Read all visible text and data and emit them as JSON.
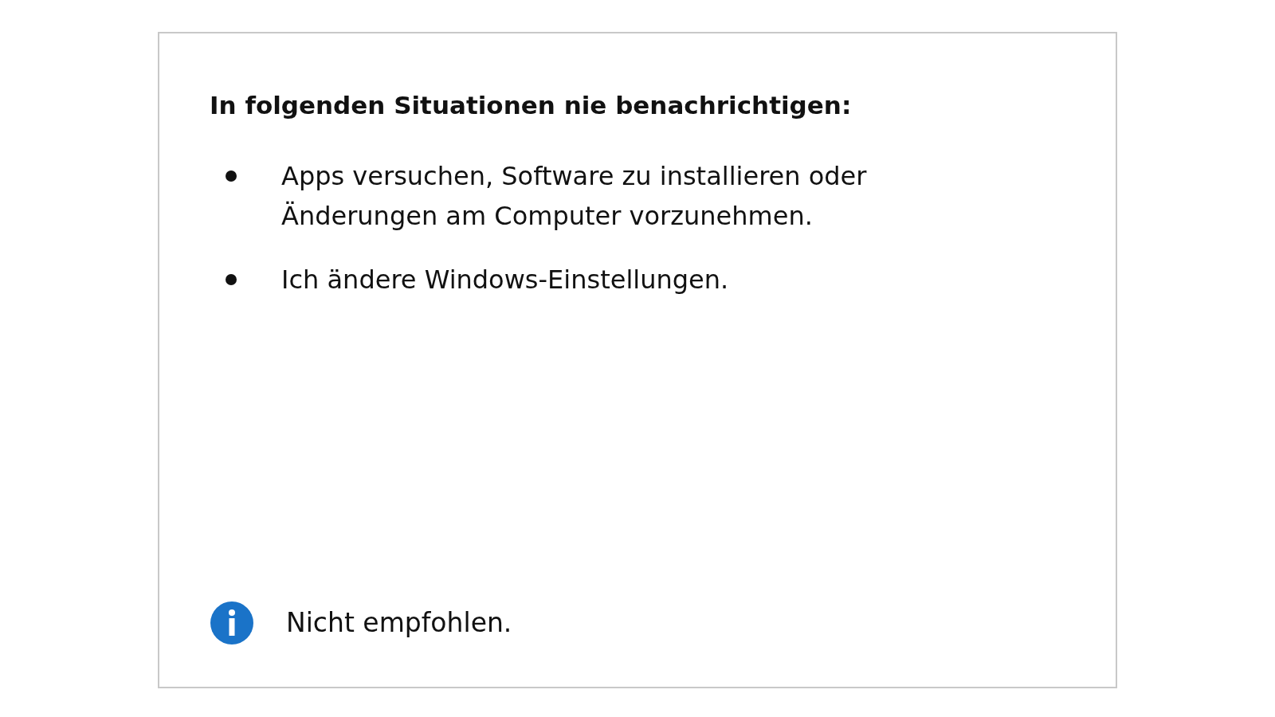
{
  "panel": {
    "heading": "In folgenden Situationen nie benachrichtigen:",
    "bullets": [
      "Apps versuchen, Software zu installieren oder Änderungen am Computer vorzunehmen.",
      "Ich ändere Windows-Einstellungen."
    ],
    "note": "Nicht empfohlen."
  }
}
